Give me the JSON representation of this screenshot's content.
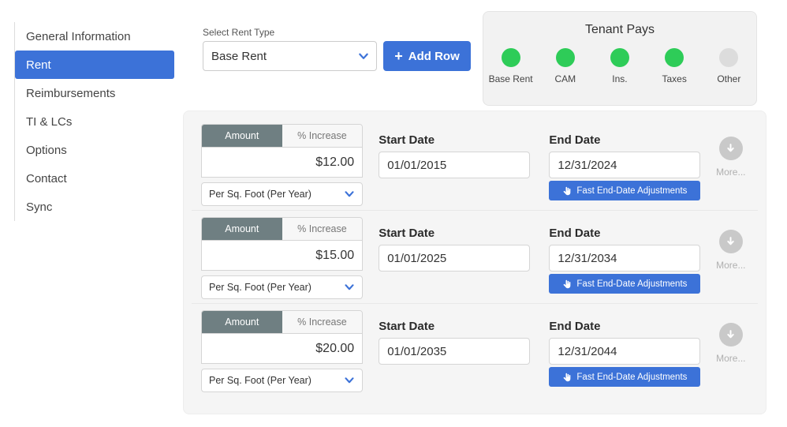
{
  "sidebar": {
    "items": [
      {
        "label": "General Information",
        "active": false
      },
      {
        "label": "Rent",
        "active": true
      },
      {
        "label": "Reimbursements",
        "active": false
      },
      {
        "label": "TI & LCs",
        "active": false
      },
      {
        "label": "Options",
        "active": false
      },
      {
        "label": "Contact",
        "active": false
      },
      {
        "label": "Sync",
        "active": false
      }
    ]
  },
  "toolbar": {
    "rent_type_label": "Select Rent Type",
    "rent_type_value": "Base Rent",
    "add_row_label": "Add Row"
  },
  "tenant_pays": {
    "title": "Tenant Pays",
    "items": [
      {
        "label": "Base Rent",
        "state": "on"
      },
      {
        "label": "CAM",
        "state": "on"
      },
      {
        "label": "Ins.",
        "state": "on"
      },
      {
        "label": "Taxes",
        "state": "on"
      },
      {
        "label": "Other",
        "state": "off"
      }
    ]
  },
  "labels": {
    "amount_toggle": "Amount",
    "percent_toggle": "% Increase",
    "start_date": "Start Date",
    "end_date": "End Date",
    "fast_adjust": "Fast End-Date Adjustments",
    "more": "More..."
  },
  "rows": [
    {
      "amount": "$12.00",
      "unit": "Per Sq. Foot (Per Year)",
      "start_date": "01/01/2015",
      "end_date": "12/31/2024"
    },
    {
      "amount": "$15.00",
      "unit": "Per Sq. Foot (Per Year)",
      "start_date": "01/01/2025",
      "end_date": "12/31/2034"
    },
    {
      "amount": "$20.00",
      "unit": "Per Sq. Foot (Per Year)",
      "start_date": "01/01/2035",
      "end_date": "12/31/2044"
    }
  ],
  "colors": {
    "accent_blue": "#3c72d8",
    "toggle_active": "#6f7f82",
    "indicator_on": "#2ecc58",
    "indicator_off": "#dcdcdc",
    "panel_bg": "#f2f2f2"
  }
}
